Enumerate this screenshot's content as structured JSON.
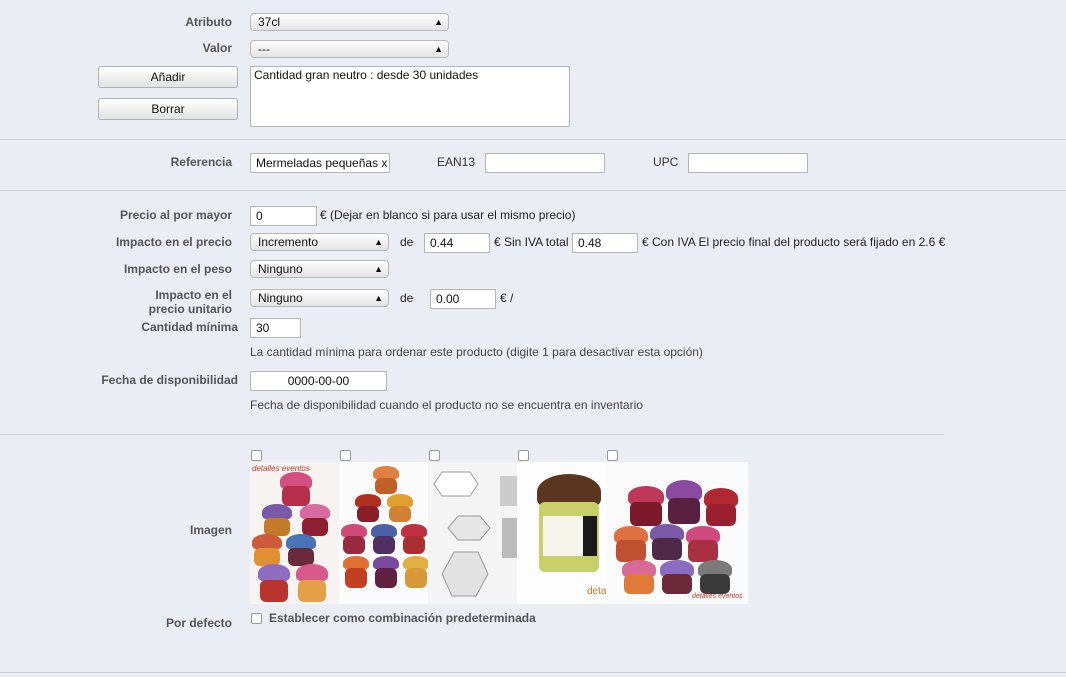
{
  "attribute": {
    "label": "Atributo",
    "value": "37cl"
  },
  "valor": {
    "label": "Valor",
    "value": "---"
  },
  "buttons": {
    "add": "Añadir",
    "delete": "Borrar"
  },
  "combination_list": [
    "Cantidad gran neutro : desde 30 unidades"
  ],
  "referencia": {
    "label": "Referencia",
    "value": "Mermeladas pequeñas x"
  },
  "ean13": {
    "label": "EAN13",
    "value": ""
  },
  "upc": {
    "label": "UPC",
    "value": ""
  },
  "wholesale": {
    "label": "Precio al por mayor",
    "value": "0",
    "note": "€ (Dejar en blanco si para usar el mismo precio)"
  },
  "price_impact": {
    "label": "Impacto en el precio",
    "type": "Incremento",
    "de": "de",
    "value": "0.44",
    "sin_iva": "€ Sin IVA total",
    "total": "0.48",
    "note": "€ Con IVA El precio final del producto será fijado en 2.6 €"
  },
  "weight_impact": {
    "label": "Impacto en el peso",
    "type": "Ninguno"
  },
  "unit_impact": {
    "label_line1": "Impacto en el",
    "label_line2": "precio unitario",
    "type": "Ninguno",
    "de": "de",
    "value": "0.00",
    "unit": "€ /"
  },
  "min_qty": {
    "label": "Cantidad mínima",
    "value": "30",
    "hint": "La cantidad mínima para ordenar este producto (digite 1 para desactivar esta opción)"
  },
  "availability": {
    "label": "Fecha de disponibilidad",
    "value": "0000-00-00",
    "hint": "Fecha de disponibilidad cuando el producto no se encuentra en inventario"
  },
  "images": {
    "label": "Imagen",
    "items": [
      {
        "name": "jar-pyramid-photo",
        "caption": "detalles eventos"
      },
      {
        "name": "jar-stack-photo",
        "caption": ""
      },
      {
        "name": "box-template-diagram",
        "caption": ""
      },
      {
        "name": "labeled-jar-photo",
        "caption": "detall"
      },
      {
        "name": "jar-tower-photo",
        "caption": "detalles eventos"
      }
    ]
  },
  "default": {
    "label": "Por defecto",
    "checkbox_label": "Establecer como combinación predeterminada"
  }
}
